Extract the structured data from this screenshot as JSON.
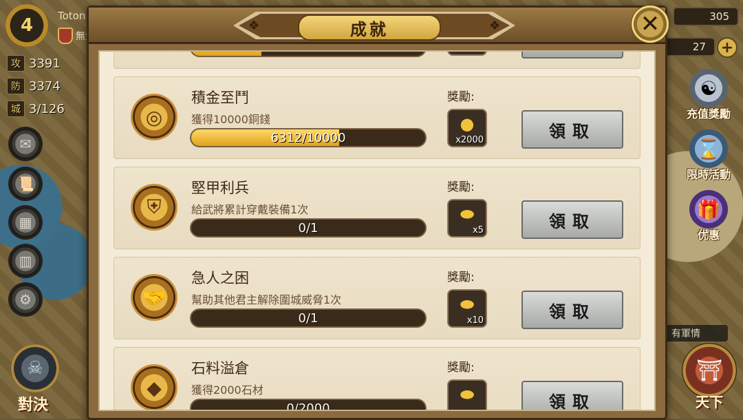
{
  "player": {
    "level": "4",
    "name": "Toton",
    "status_badge": "免",
    "status_text": "無免",
    "stats": [
      {
        "badge": "攻",
        "value": "3391"
      },
      {
        "badge": "防",
        "value": "3374"
      },
      {
        "badge": "城",
        "value": "3/126"
      }
    ]
  },
  "resources": {
    "top": "305",
    "second": "27"
  },
  "sidebar_right": [
    {
      "label": "充值獎勵",
      "icon": "sage-icon"
    },
    {
      "label": "限時活動",
      "icon": "hourglass-icon"
    },
    {
      "label": "优惠",
      "icon": "gift-box-icon"
    }
  ],
  "news_tag": "有軍情",
  "world_label": "天下",
  "duel_label": "對決",
  "dialog": {
    "title": "成就",
    "reward_label": "獎勵:",
    "claim_label": "領取",
    "achievements": [
      {
        "title": "積金至鬥",
        "desc": "獲得10000銅錢",
        "progress_text": "6312/10000",
        "progress_fraction": 0.6312,
        "reward_qty": "x2000",
        "reward_icon": "copper-coin-icon",
        "icon": "coins-icon"
      },
      {
        "title": "堅甲利兵",
        "desc": "給武將累計穿戴裝備1次",
        "progress_text": "0/1",
        "progress_fraction": 0,
        "reward_qty": "x5",
        "reward_icon": "gold-ingot-icon",
        "icon": "armor-icon"
      },
      {
        "title": "急人之困",
        "desc": "幫助其他君主解除圍城威脅1次",
        "progress_text": "0/1",
        "progress_fraction": 0,
        "reward_qty": "x10",
        "reward_icon": "gold-ingot-icon",
        "icon": "handshake-icon"
      },
      {
        "title": "石料溢倉",
        "desc": "獲得2000石材",
        "progress_text": "0/2000",
        "progress_fraction": 0,
        "reward_qty": "",
        "reward_icon": "gold-ingot-icon",
        "icon": "stone-icon"
      }
    ]
  }
}
